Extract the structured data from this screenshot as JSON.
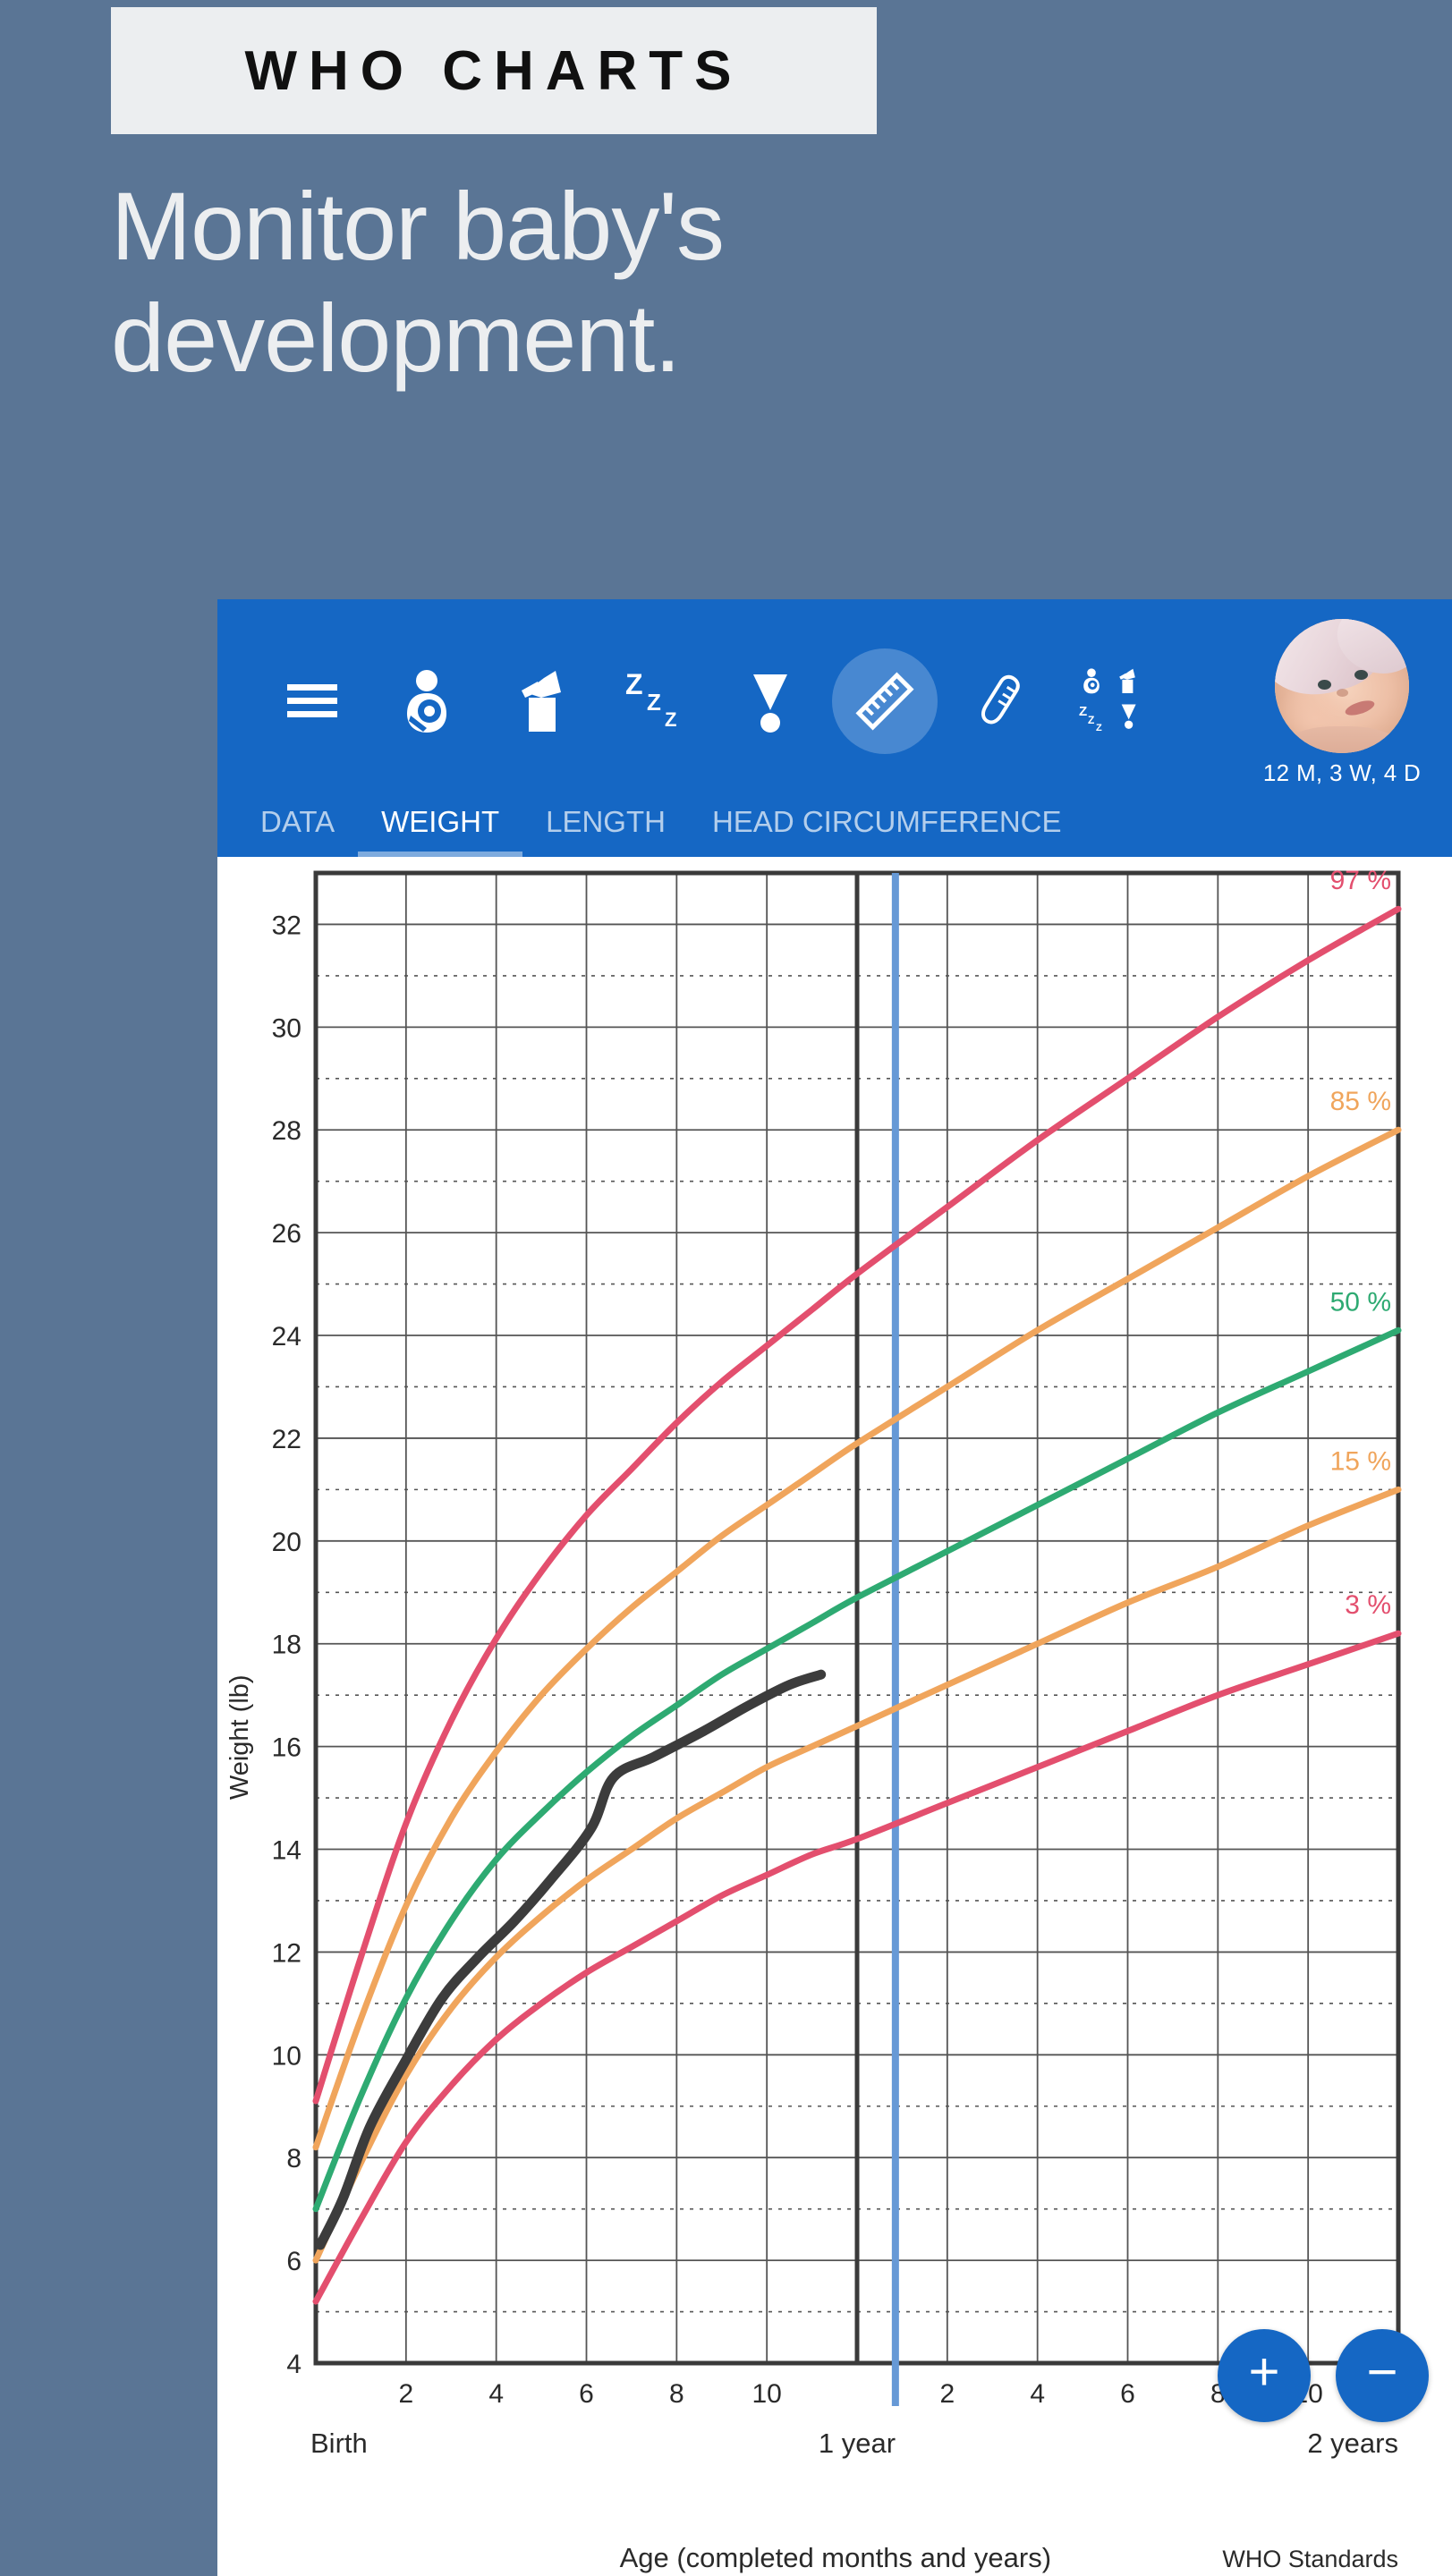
{
  "promo": {
    "badge": "WHO CHARTS",
    "headline": "Monitor baby's development."
  },
  "colors": {
    "background": "#5a7595",
    "badge_bg": "#eceef0",
    "headline_text": "#eceef0",
    "appbar": "#1567c4",
    "accent": "#1567c4",
    "today_line": "#6699d6",
    "p97": "#e34f6e",
    "p85": "#f0a55c",
    "p50": "#2eaa72",
    "p15": "#f0a55c",
    "p3": "#e34f6e",
    "measurement_line": "#3c3c3c"
  },
  "appbar": {
    "icons": [
      {
        "name": "menu-icon",
        "label": "Menu",
        "selected": false
      },
      {
        "name": "breastfeeding-icon",
        "label": "Breastfeeding",
        "selected": false
      },
      {
        "name": "breast-pump-icon",
        "label": "Pumping",
        "selected": false
      },
      {
        "name": "sleep-icon",
        "label": "Sleep",
        "selected": false
      },
      {
        "name": "diaper-icon",
        "label": "Diaper",
        "selected": false
      },
      {
        "name": "ruler-icon",
        "label": "Growth",
        "selected": true
      },
      {
        "name": "thermometer-icon",
        "label": "Temperature",
        "selected": false
      },
      {
        "name": "all-activities-icon",
        "label": "All activities",
        "selected": false
      }
    ],
    "avatar": {
      "name": "baby-avatar",
      "age": "12 M, 3 W, 4 D"
    }
  },
  "tabs": [
    {
      "label": "DATA",
      "active": false
    },
    {
      "label": "WEIGHT",
      "active": true
    },
    {
      "label": "LENGTH",
      "active": false
    },
    {
      "label": "HEAD CIRCUMFERENCE",
      "active": false
    }
  ],
  "fabs": [
    {
      "name": "add-measurement-fab",
      "label": "+"
    },
    {
      "name": "remove-measurement-fab",
      "label": "−"
    }
  ],
  "chart_data": {
    "type": "line",
    "title": "",
    "source_note": "WHO Standards",
    "xlabel": "Age (completed months and years)",
    "ylabel": "Weight (lb)",
    "xlim": [
      0,
      24
    ],
    "ylim": [
      4,
      33
    ],
    "grid": true,
    "y_major_ticks": [
      4,
      6,
      8,
      10,
      12,
      14,
      16,
      18,
      20,
      22,
      24,
      26,
      28,
      30,
      32
    ],
    "y_minor_ticks": [
      5,
      7,
      9,
      11,
      13,
      15,
      17,
      19,
      21,
      23,
      25,
      27,
      29,
      31
    ],
    "x_major_ticks": [
      0,
      2,
      4,
      6,
      8,
      10,
      12,
      14,
      16,
      18,
      20,
      22,
      24
    ],
    "x_tick_labels": [
      "",
      "2",
      "4",
      "6",
      "8",
      "10",
      "",
      "2",
      "4",
      "6",
      "8",
      "10",
      ""
    ],
    "x_boundary_labels": [
      {
        "label": "Birth",
        "x": 0
      },
      {
        "label": "1 year",
        "x": 12
      },
      {
        "label": "2 years",
        "x": 24
      }
    ],
    "today_marker": {
      "label": "today",
      "x": 12.85
    },
    "legend_position": "right-inline",
    "series": [
      {
        "name": "97 %",
        "label": "97 %",
        "color": "#e34f6e",
        "x": [
          0,
          1,
          2,
          3,
          4,
          5,
          6,
          7,
          8,
          9,
          10,
          11,
          12,
          14,
          16,
          18,
          20,
          22,
          24
        ],
        "values": [
          9.1,
          11.9,
          14.5,
          16.5,
          18.1,
          19.4,
          20.5,
          21.4,
          22.3,
          23.1,
          23.8,
          24.5,
          25.2,
          26.5,
          27.8,
          29.0,
          30.2,
          31.3,
          32.3
        ]
      },
      {
        "name": "85 %",
        "label": "85 %",
        "color": "#f0a55c",
        "x": [
          0,
          1,
          2,
          3,
          4,
          5,
          6,
          7,
          8,
          9,
          10,
          11,
          12,
          14,
          16,
          18,
          20,
          22,
          24
        ],
        "values": [
          8.2,
          10.7,
          12.9,
          14.6,
          15.9,
          17.0,
          17.9,
          18.7,
          19.4,
          20.1,
          20.7,
          21.3,
          21.9,
          23.0,
          24.1,
          25.1,
          26.1,
          27.1,
          28.0
        ]
      },
      {
        "name": "50 %",
        "label": "50 %",
        "color": "#2eaa72",
        "x": [
          0,
          1,
          2,
          3,
          4,
          5,
          6,
          7,
          8,
          9,
          10,
          11,
          12,
          14,
          16,
          18,
          20,
          22,
          24
        ],
        "values": [
          7.0,
          9.2,
          11.1,
          12.6,
          13.8,
          14.7,
          15.5,
          16.2,
          16.8,
          17.4,
          17.9,
          18.4,
          18.9,
          19.8,
          20.7,
          21.6,
          22.5,
          23.3,
          24.1
        ]
      },
      {
        "name": "15 %",
        "label": "15 %",
        "color": "#f0a55c",
        "x": [
          0,
          1,
          2,
          3,
          4,
          5,
          6,
          7,
          8,
          9,
          10,
          11,
          12,
          14,
          16,
          18,
          20,
          22,
          24
        ],
        "values": [
          6.0,
          7.9,
          9.6,
          10.9,
          11.9,
          12.7,
          13.4,
          14.0,
          14.6,
          15.1,
          15.6,
          16.0,
          16.4,
          17.2,
          18.0,
          18.8,
          19.5,
          20.3,
          21.0
        ]
      },
      {
        "name": "3 %",
        "label": "3 %",
        "color": "#e34f6e",
        "x": [
          0,
          1,
          2,
          3,
          4,
          5,
          6,
          7,
          8,
          9,
          10,
          11,
          12,
          14,
          16,
          18,
          20,
          22,
          24
        ],
        "values": [
          5.2,
          6.8,
          8.3,
          9.4,
          10.3,
          11.0,
          11.6,
          12.1,
          12.6,
          13.1,
          13.5,
          13.9,
          14.2,
          14.9,
          15.6,
          16.3,
          17.0,
          17.6,
          18.2
        ]
      },
      {
        "name": "measurements",
        "label": "",
        "color": "#3c3c3c",
        "x": [
          0.1,
          0.6,
          1.2,
          2.0,
          2.8,
          3.6,
          4.4,
          5.2,
          6.1,
          6.6,
          7.5,
          8.6,
          9.6,
          10.5,
          11.2
        ],
        "values": [
          6.3,
          7.2,
          8.6,
          9.9,
          11.1,
          11.9,
          12.6,
          13.4,
          14.4,
          15.4,
          15.8,
          16.3,
          16.8,
          17.2,
          17.4
        ]
      }
    ]
  }
}
